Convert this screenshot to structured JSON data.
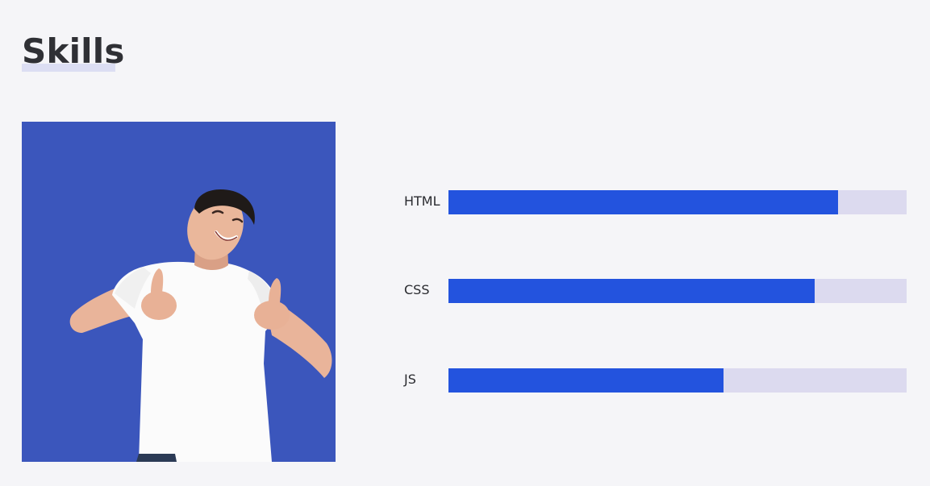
{
  "section": {
    "title": "Skills"
  },
  "photo": {
    "alt": "Smiling man in white t-shirt giving two thumbs up",
    "background": "#3b56bc"
  },
  "skills": [
    {
      "label": "HTML",
      "level": 0.85
    },
    {
      "label": "CSS",
      "level": 0.8
    },
    {
      "label": "JS",
      "level": 0.6
    }
  ],
  "colors": {
    "bar_fill": "#2353de",
    "bar_track": "#dcdaef",
    "title_underline": "#dcdef3",
    "text": "#2f3035",
    "page_background": "#f5f5f8"
  }
}
